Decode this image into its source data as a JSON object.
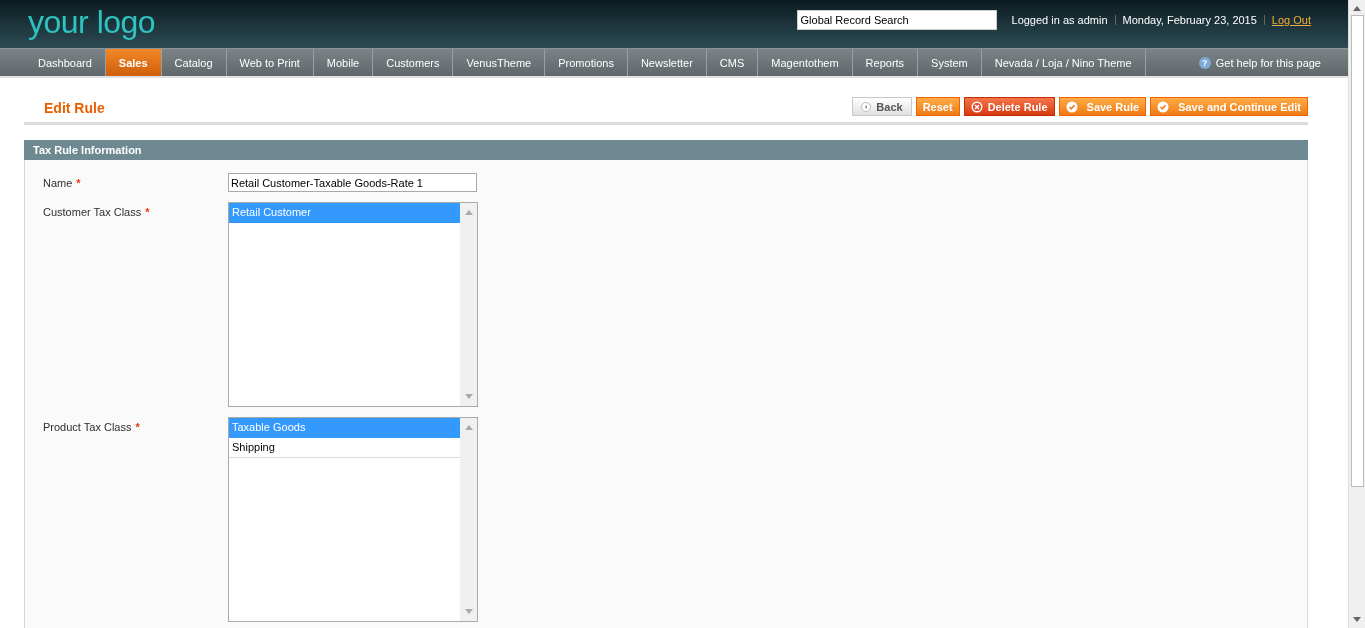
{
  "header": {
    "logo": "your logo",
    "search": {
      "value": "Global Record Search"
    },
    "user_info": "Logged in as admin",
    "date": "Monday, February 23, 2015",
    "logout": "Log Out"
  },
  "nav": [
    {
      "label": "Dashboard",
      "selected": false
    },
    {
      "label": "Sales",
      "selected": true
    },
    {
      "label": "Catalog",
      "selected": false
    },
    {
      "label": "Web to Print",
      "selected": false
    },
    {
      "label": "Mobile",
      "selected": false
    },
    {
      "label": "Customers",
      "selected": false
    },
    {
      "label": "VenusTheme",
      "selected": false
    },
    {
      "label": "Promotions",
      "selected": false
    },
    {
      "label": "Newsletter",
      "selected": false
    },
    {
      "label": "CMS",
      "selected": false
    },
    {
      "label": "Magentothem",
      "selected": false
    },
    {
      "label": "Reports",
      "selected": false
    },
    {
      "label": "System",
      "selected": false
    },
    {
      "label": "Nevada / Loja / Nino Theme",
      "selected": false
    }
  ],
  "help_link": "Get help for this page",
  "help_icon": "?",
  "page_title": "Edit Rule",
  "buttons": [
    {
      "label": "Back",
      "kind": "back"
    },
    {
      "label": "Reset",
      "kind": "plain"
    },
    {
      "label": "Delete Rule",
      "kind": "delete"
    },
    {
      "label": "Save Rule",
      "kind": "save"
    },
    {
      "label": "Save and Continue Edit",
      "kind": "save"
    }
  ],
  "section": {
    "title": "Tax Rule Information",
    "fields": [
      {
        "kind": "text",
        "label": "Name",
        "required_mark": "*",
        "value": "Retail Customer-Taxable Goods-Rate 1"
      },
      {
        "kind": "multiselect",
        "label": "Customer Tax Class",
        "required_mark": "*",
        "options": [
          {
            "label": "Retail Customer",
            "selected": true
          }
        ]
      },
      {
        "kind": "multiselect",
        "label": "Product Tax Class",
        "required_mark": "*",
        "options": [
          {
            "label": "Taxable Goods",
            "selected": true
          },
          {
            "label": "Shipping",
            "selected": false
          }
        ]
      }
    ]
  }
}
